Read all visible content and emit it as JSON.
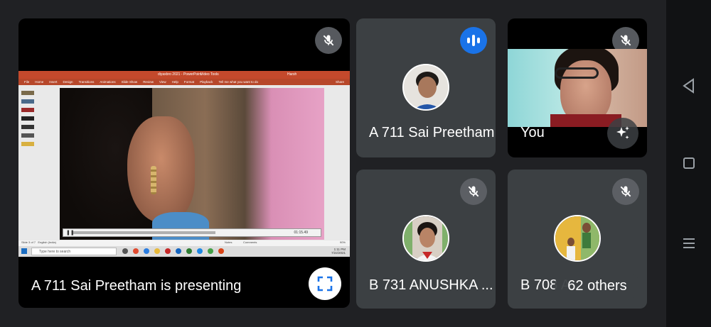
{
  "presentation": {
    "caption": "A 711 Sai Preetham is presenting",
    "powerpoint": {
      "title": "diyaxbro 2021 - PowerPoint",
      "video_tools": "Video Tools",
      "search_hint": "Tell me what you want to do",
      "user": "Harsh",
      "share": "Share",
      "menu": [
        "File",
        "Home",
        "Insert",
        "Design",
        "Transitions",
        "Animations",
        "Slide Show",
        "Review",
        "View",
        "Help",
        "Format",
        "Playback"
      ],
      "status_slide": "Slide 3 of 7",
      "status_lang": "English (India)",
      "status_notes": "Notes",
      "status_comments": "Comments",
      "zoom": "90%",
      "video_time": "01:15.49",
      "taskbar_search": "Type here to search",
      "clock_time": "1:11 PM",
      "clock_date": "7/22/2021"
    }
  },
  "participants": [
    {
      "name": "A 711 Sai Preetham",
      "state": "speaking"
    },
    {
      "name": "You",
      "state": "muted"
    },
    {
      "name": "B 731 ANUSHKA ...",
      "state": "muted"
    },
    {
      "name": "B 708 A...",
      "state": "muted"
    }
  ],
  "others_count": "62 others",
  "icons": {
    "mute": "mic-off-icon",
    "speaking": "audio-level-icon",
    "effects": "sparkle-icon",
    "fullscreen": "expand-icon"
  },
  "colors": {
    "background": "#202124",
    "tile": "#3c4043",
    "accent": "#1a73e8",
    "powerpoint": "#c4492c"
  }
}
